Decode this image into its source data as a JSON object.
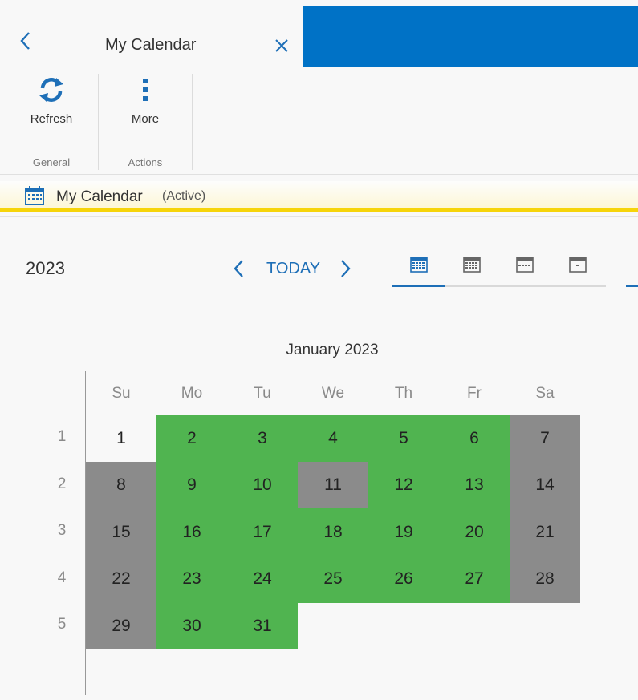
{
  "tab": {
    "title": "My Calendar"
  },
  "ribbon": {
    "refresh_label": "Refresh",
    "more_label": "More",
    "group_general": "General",
    "group_actions": "Actions"
  },
  "infobar": {
    "title": "My Calendar",
    "status": "(Active)"
  },
  "nav": {
    "year": "2023",
    "today_label": "TODAY"
  },
  "calendar": {
    "month_title": "January 2023",
    "weekdays": [
      "Su",
      "Mo",
      "Tu",
      "We",
      "Th",
      "Fr",
      "Sa"
    ],
    "weeks": [
      {
        "number": "1",
        "days": [
          {
            "d": "1",
            "s": "none"
          },
          {
            "d": "2",
            "s": "green"
          },
          {
            "d": "3",
            "s": "green"
          },
          {
            "d": "4",
            "s": "green"
          },
          {
            "d": "5",
            "s": "green"
          },
          {
            "d": "6",
            "s": "green"
          },
          {
            "d": "7",
            "s": "gray"
          }
        ]
      },
      {
        "number": "2",
        "days": [
          {
            "d": "8",
            "s": "gray"
          },
          {
            "d": "9",
            "s": "green"
          },
          {
            "d": "10",
            "s": "green"
          },
          {
            "d": "11",
            "s": "gray"
          },
          {
            "d": "12",
            "s": "green"
          },
          {
            "d": "13",
            "s": "green"
          },
          {
            "d": "14",
            "s": "gray"
          }
        ]
      },
      {
        "number": "3",
        "days": [
          {
            "d": "15",
            "s": "gray"
          },
          {
            "d": "16",
            "s": "green"
          },
          {
            "d": "17",
            "s": "green"
          },
          {
            "d": "18",
            "s": "green"
          },
          {
            "d": "19",
            "s": "green"
          },
          {
            "d": "20",
            "s": "green"
          },
          {
            "d": "21",
            "s": "gray"
          }
        ]
      },
      {
        "number": "4",
        "days": [
          {
            "d": "22",
            "s": "gray"
          },
          {
            "d": "23",
            "s": "green"
          },
          {
            "d": "24",
            "s": "green"
          },
          {
            "d": "25",
            "s": "green"
          },
          {
            "d": "26",
            "s": "green"
          },
          {
            "d": "27",
            "s": "green"
          },
          {
            "d": "28",
            "s": "gray"
          }
        ]
      },
      {
        "number": "5",
        "days": [
          {
            "d": "29",
            "s": "gray"
          },
          {
            "d": "30",
            "s": "green"
          },
          {
            "d": "31",
            "s": "green"
          }
        ]
      }
    ]
  },
  "colors": {
    "accent": "#1e6fb7",
    "topbar": "#0072c6",
    "working_day": "#50b450",
    "non_working_day": "#8b8b8b",
    "active_bar": "#f6d40a"
  },
  "icons": {
    "back": "chevron-left-icon",
    "close": "close-icon",
    "refresh": "refresh-icon",
    "more": "more-vertical-icon",
    "calendar": "calendar-icon"
  }
}
